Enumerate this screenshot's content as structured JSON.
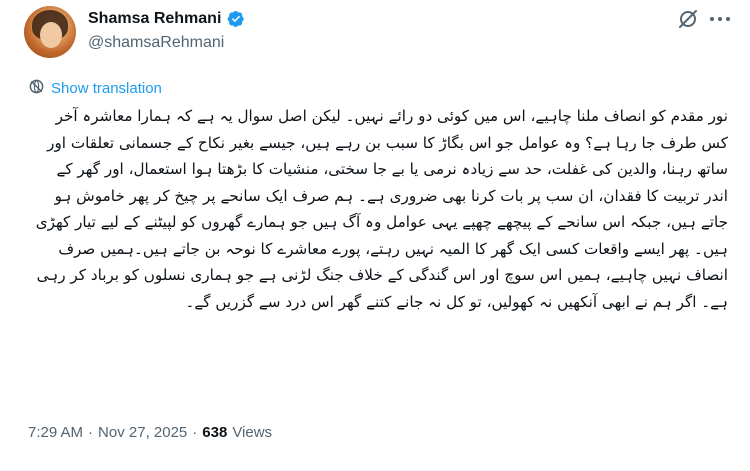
{
  "author": {
    "display_name": "Shamsa Rehmani",
    "handle": "@shamsaRehmani",
    "verified": true
  },
  "actions": {
    "translate_label": "Show translation"
  },
  "tweet": {
    "text": "نور مقدم کو انصاف ملنا چاہیے، اس میں کوئی دو رائے نہیں۔ لیکن اصل سوال یہ ہے کہ ہمارا معاشرہ آخر کس طرف جا رہا ہے؟ وہ عوامل جو اس بگاڑ کا سبب بن رہے ہیں، جیسے بغیر نکاح کے جسمانی تعلقات اور ساتھ رہنا، والدین کی غفلت، حد سے زیادہ نرمی یا بے جا سختی، منشیات کا بڑھتا ہوا استعمال، اور گھر کے اندر تربیت کا فقدان، ان سب پر بات کرنا بھی ضروری ہے۔ ہم صرف ایک سانحے پر چیخ کر پھر خاموش ہو جاتے ہیں، جبکہ اس سانحے کے پیچھے چھپے یہی عوامل وہ آگ ہیں جو ہمارے گھروں کو لپیٹنے کے لیے تیار کھڑی ہیں۔ پھر ایسے واقعات کسی ایک گھر کا المیہ نہیں رہتے، پورے معاشرے کا نوحہ بن جاتے ہیں۔ہمیں صرف انصاف نہیں چاہیے، ہمیں اس سوچ اور اس گندگی کے خلاف جنگ لڑنی ہے جو ہماری نسلوں کو برباد کر رہی ہے۔ اگر ہم نے ابھی آنکھیں نہ کھولیں، تو کل نہ جانے کتنے گھر اس درد سے گزریں گے۔"
  },
  "meta": {
    "time": "7:29 AM",
    "separator1": "·",
    "date": "Nov 27, 2025",
    "separator2": "·",
    "views_count": "638",
    "views_label": "Views"
  },
  "colors": {
    "accent": "#1d9bf0",
    "secondary_text": "#536471",
    "primary_text": "#0f1419"
  },
  "icons": {
    "verified": "verified-badge-icon",
    "grok": "grok-icon",
    "more": "more-dots-icon",
    "translate": "translate-icon"
  }
}
